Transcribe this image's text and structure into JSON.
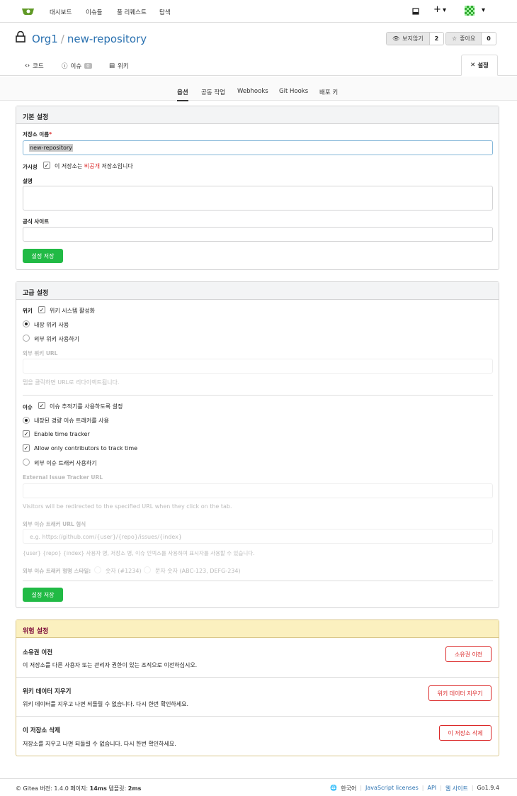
{
  "nav": {
    "items": [
      "대시보드",
      "이슈들",
      "풀 리퀘스트",
      "탐색"
    ],
    "plus": "+",
    "caret": "▾"
  },
  "repo": {
    "owner": "Org1",
    "separator": "/",
    "name": "new-repository",
    "watch_label": "보지않기",
    "watch_count": "2",
    "star_label": "좋아요",
    "star_count": "0",
    "tabs": {
      "code": "코드",
      "issues": "이슈",
      "issues_count": "0",
      "wiki": "위키",
      "settings": "설정"
    }
  },
  "subnav": {
    "tabs": [
      "옵션",
      "공동 작업",
      "Webhooks",
      "Git Hooks",
      "배포 키"
    ]
  },
  "basic": {
    "header": "기본 설정",
    "name_label": "저장소 이름",
    "name_required": "*",
    "name_value": "new-repository",
    "visibility_label": "가시성",
    "visibility_pre": "이 저장소는",
    "visibility_link": "비공개",
    "visibility_post": "저장소입니다",
    "desc_label": "설명",
    "website_label": "공식 사이트",
    "save": "설정 저장"
  },
  "advanced": {
    "header": "고급 설정",
    "wiki_label": "위키",
    "wiki_enable": "위키 시스템 활성화",
    "wiki_internal": "내장 위키 사용",
    "wiki_external": "외부 위키 사용하기",
    "wiki_url_label": "외부 위키 URL",
    "wiki_url_help": "탭을 클릭하면 URL로 리다이렉트됩니다.",
    "issue_label": "이슈",
    "issue_enable": "이슈 추적기를 사용하도록 설정",
    "issue_internal": "내장된 경량 이슈 트래커를 사용",
    "time_tracker": "Enable time tracker",
    "contributors_time": "Allow only contributors to track time",
    "issue_external": "외부 이슈 트래커 사용하기",
    "ext_url_label": "External Issue Tracker URL",
    "ext_url_help": "Visitors will be redirected to the specified URL when they click on the tab.",
    "format_label": "외부 이슈 트래커 URL 형식",
    "format_placeholder": "e.g. https://github.com/{user}/{repo}/issues/{index}",
    "format_help": "{user} {repo} {index} 사용자 명, 저장소 명, 이슈 인덱스를 사용하여 표시자를 사용할 수 있습니다.",
    "style_label": "외부 이슈 트래커 형명 스타일:",
    "style_numeric": "숫자 (#1234)",
    "style_alpha": "문자 숫자 (ABC-123, DEFG-234)",
    "save": "설정 저장"
  },
  "danger": {
    "header": "위험 설정",
    "transfer_title": "소유권 이전",
    "transfer_desc": "이 저장소를 다른 사용자 또는 관리자 권한이 있는 조직으로 이전하십시오.",
    "transfer_btn": "소유권 이전",
    "wiki_title": "위키 데이터 지우기",
    "wiki_desc": "위키 데이터를 지우고 나면 되돌릴 수 없습니다. 다시 한번 확인하세요.",
    "wiki_btn": "위키 데이터 지우기",
    "delete_title": "이 저장소 삭제",
    "delete_desc": "저장소를 지우고 나면 되돌릴 수 없습니다. 다시 한번 확인하세요.",
    "delete_btn": "이 저장소 삭제"
  },
  "footer": {
    "left_pre": "© Gitea 버전: 1.4.0 페이지: ",
    "page_time": "14ms",
    "left_mid": " 템플릿: ",
    "tpl_time": "2ms",
    "language": "한국어",
    "licenses": "JavaScript licenses",
    "api": "API",
    "website": "웹 사이트",
    "go": "Go1.9.4"
  },
  "colors": {
    "accent": "#2a71b0",
    "green": "#21ba45",
    "danger": "#db2828"
  }
}
